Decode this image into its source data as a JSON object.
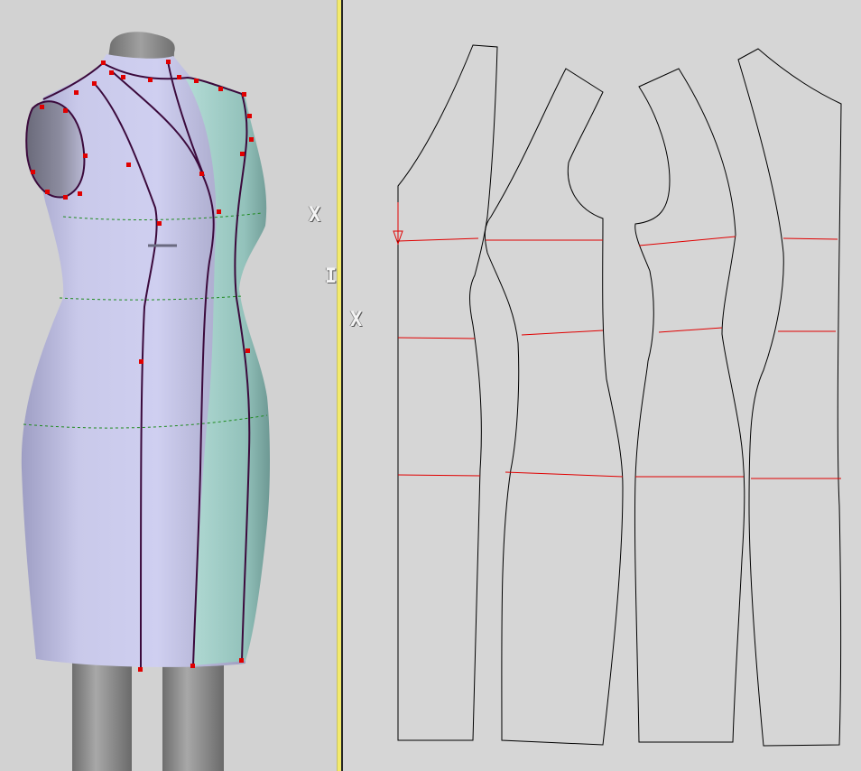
{
  "app": {
    "views": [
      "3d-mannequin-view",
      "2d-pattern-view"
    ]
  },
  "gizmo": {
    "labels": [
      "X",
      "I",
      "X"
    ]
  },
  "colors": {
    "background": "#d4d4d4",
    "splitter": "#f3ea6c",
    "body_front": "#c9c9e6",
    "body_side": "#9bc8c2",
    "seam_line": "#3b0a3c",
    "control_point": "#e00000",
    "guide_line": "#1e8a1e",
    "pattern_outline": "#000000",
    "pattern_measure_line": "#e00000",
    "stand_pole": "#8a8a8a"
  },
  "pattern": {
    "pieces": [
      "center-front",
      "side-front",
      "side-back",
      "center-back"
    ],
    "measure_lines": [
      "bust-line",
      "waist-line",
      "hip-line"
    ]
  }
}
